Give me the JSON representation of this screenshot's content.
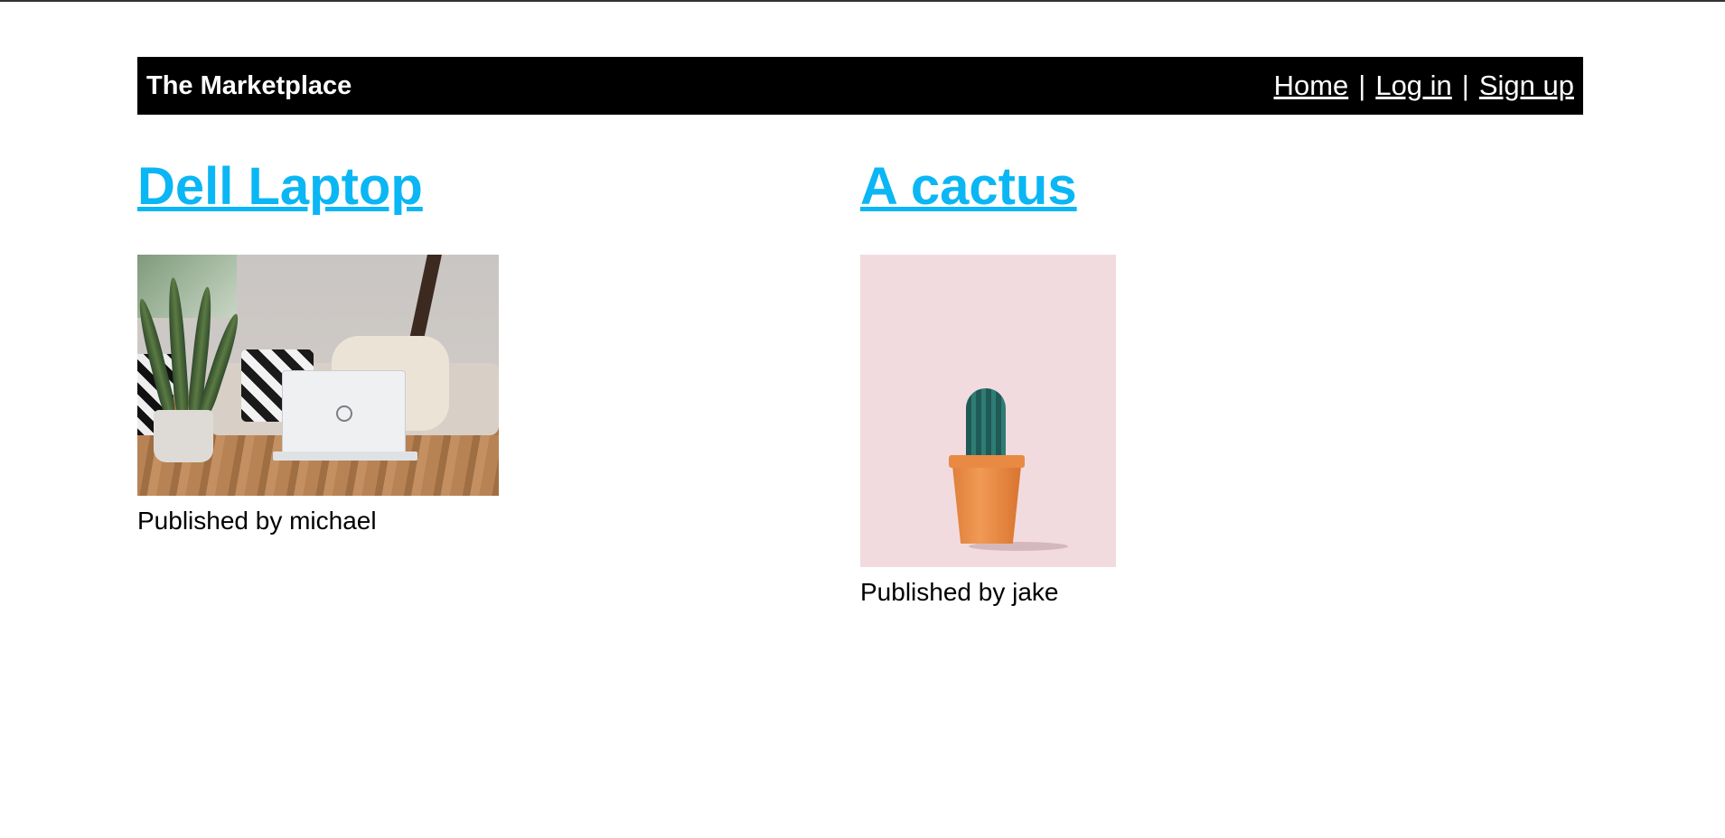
{
  "header": {
    "brand": "The Marketplace",
    "nav": {
      "home": "Home",
      "separator": "|",
      "login": "Log in",
      "signup": "Sign up"
    }
  },
  "listings": [
    {
      "title": "Dell Laptop",
      "published_prefix": "Published by ",
      "author": "michael",
      "image_icon": "laptop-photo"
    },
    {
      "title": "A cactus",
      "published_prefix": "Published by ",
      "author": "jake",
      "image_icon": "cactus-photo"
    }
  ],
  "colors": {
    "navbar_bg": "#000000",
    "navbar_text": "#ffffff",
    "title_link": "#0bb6f4",
    "body_text": "#000000"
  }
}
